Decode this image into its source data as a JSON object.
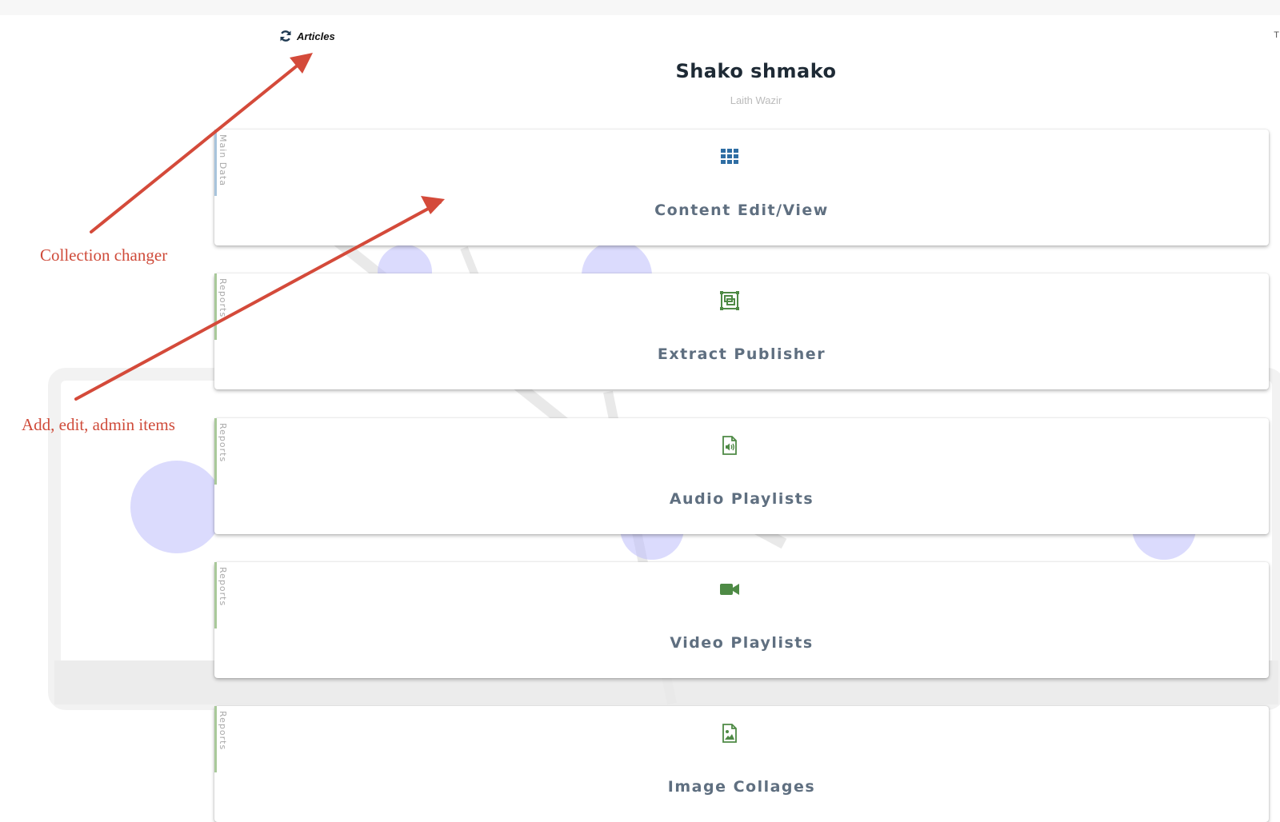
{
  "header": {
    "collection_label": "Articles",
    "corner_text": "T",
    "title": "Shako shmako",
    "subtitle": "Laith Wazir"
  },
  "cards": [
    {
      "tag": "Main Data",
      "label": "Content Edit/View",
      "icon": "grid-icon",
      "accent": "#a8c4dc"
    },
    {
      "tag": "Reports",
      "label": "Extract Publisher",
      "icon": "publish-frame-icon",
      "accent": "#a9c99a"
    },
    {
      "tag": "Reports",
      "label": "Audio Playlists",
      "icon": "audio-file-icon",
      "accent": "#a9c99a"
    },
    {
      "tag": "Reports",
      "label": "Video Playlists",
      "icon": "video-camera-icon",
      "accent": "#a9c99a"
    },
    {
      "tag": "Reports",
      "label": "Image Collages",
      "icon": "image-file-icon",
      "accent": "#a9c99a"
    }
  ],
  "annotations": {
    "collection_changer": "Collection changer",
    "add_edit_admin": "Add, edit, admin items"
  },
  "colors": {
    "annotation_red": "#cf4b3a",
    "icon_blue": "#2f6ea3",
    "icon_green": "#4e8a45",
    "title_dark": "#1e2a35"
  }
}
